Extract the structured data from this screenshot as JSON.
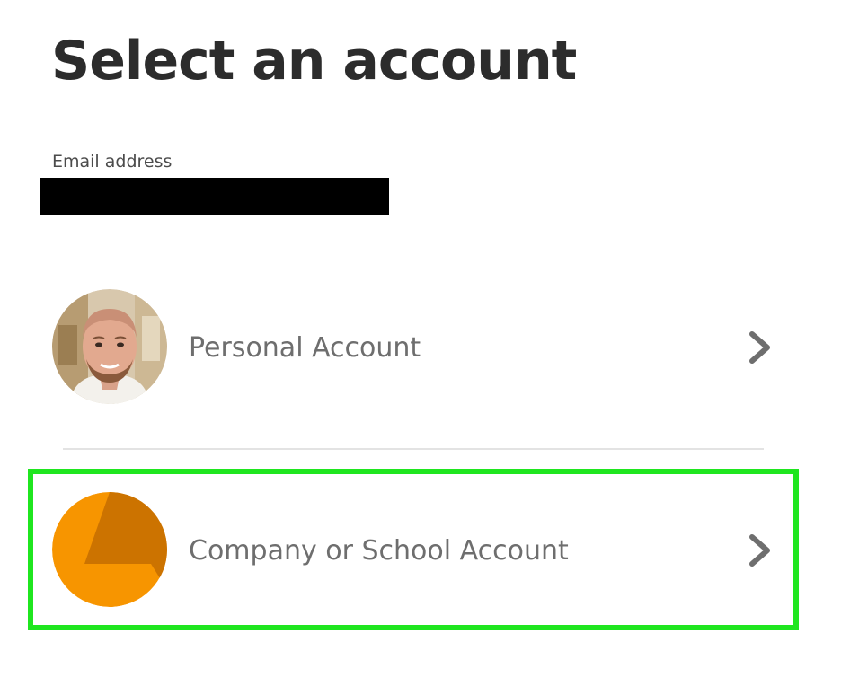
{
  "page": {
    "title": "Select an account"
  },
  "email": {
    "label": "Email address",
    "value": ""
  },
  "accounts": [
    {
      "label": "Personal Account",
      "avatar_icon": "profile-photo-avatar",
      "chevron_icon": "chevron-right-icon"
    },
    {
      "label": "Company or School Account",
      "avatar_icon": "orange-organization-avatar",
      "chevron_icon": "chevron-right-icon",
      "highlighted": true
    }
  ],
  "colors": {
    "title": "#2c2c2c",
    "label": "#6e6e6e",
    "divider": "#e3e3e3",
    "highlight": "#1fe61f",
    "company_avatar_light": "#f79500",
    "company_avatar_dark": "#cc7300",
    "chevron": "#6e6e6e"
  }
}
